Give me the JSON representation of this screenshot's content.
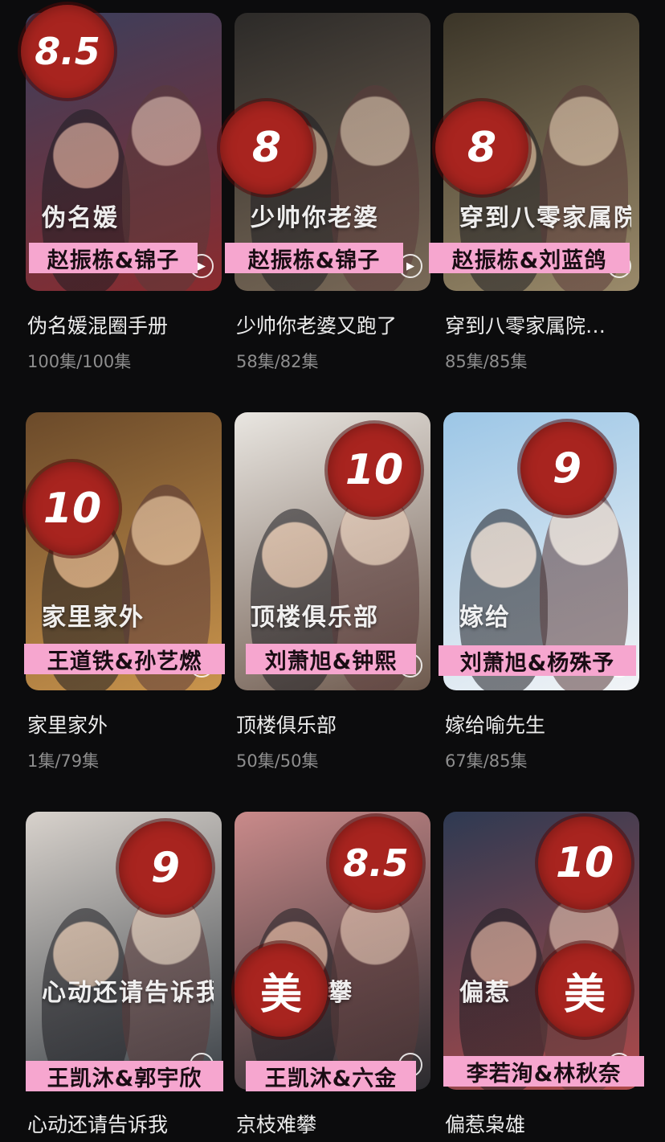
{
  "cards": [
    {
      "title": "伪名媛混圈手册",
      "episodes": "100集/100集",
      "rating": "8.5",
      "cast": "赵振栋&锦子",
      "poster_text": "伪名媛",
      "colors": [
        "#3a3f5c",
        "#8b2b2e"
      ]
    },
    {
      "title": "少帅你老婆又跑了",
      "episodes": "58集/82集",
      "rating": "8",
      "cast": "赵振栋&锦子",
      "poster_text": "少帅你老婆",
      "colors": [
        "#2c2a28",
        "#7a6a58"
      ]
    },
    {
      "title": "穿到八零家属院…",
      "episodes": "85集/85集",
      "rating": "8",
      "cast": "赵振栋&刘蓝鸽",
      "poster_text": "穿到八零家属院",
      "colors": [
        "#3b3528",
        "#9a8a6a"
      ]
    },
    {
      "title": "家里家外",
      "episodes": "1集/79集",
      "rating": "10",
      "cast": "王道铁&孙艺燃",
      "poster_text": "家里家外",
      "colors": [
        "#6b4a2a",
        "#c9944c"
      ]
    },
    {
      "title": "顶楼俱乐部",
      "episodes": "50集/50集",
      "rating": "10",
      "cast": "刘萧旭&钟熙",
      "poster_text": "顶楼俱乐部",
      "colors": [
        "#e9e6e1",
        "#6e5a4e"
      ]
    },
    {
      "title": "嫁给喻先生",
      "episodes": "67集/85集",
      "rating": "9",
      "cast": "刘萧旭&杨殊予",
      "poster_text": "嫁给",
      "colors": [
        "#9cc6e6",
        "#f2f4f6"
      ]
    },
    {
      "title": "心动还请告诉我",
      "episodes": "",
      "rating": "9",
      "cast": "王凯沐&郭宇欣",
      "poster_text": "心动还请告诉我",
      "colors": [
        "#d8d2cc",
        "#3a4046"
      ]
    },
    {
      "title": "京枝难攀",
      "episodes": "",
      "rating": "8.5",
      "cast": "王凯沐&六金",
      "tag": "美",
      "poster_text": "京枝难攀",
      "colors": [
        "#c98a8a",
        "#2a2a2e"
      ]
    },
    {
      "title": "偏惹枭雄",
      "episodes": "",
      "rating": "10",
      "cast": "李若洵&林秋奈",
      "tag": "美",
      "poster_text": "偏惹",
      "colors": [
        "#2e3a52",
        "#b04a4a"
      ]
    }
  ]
}
